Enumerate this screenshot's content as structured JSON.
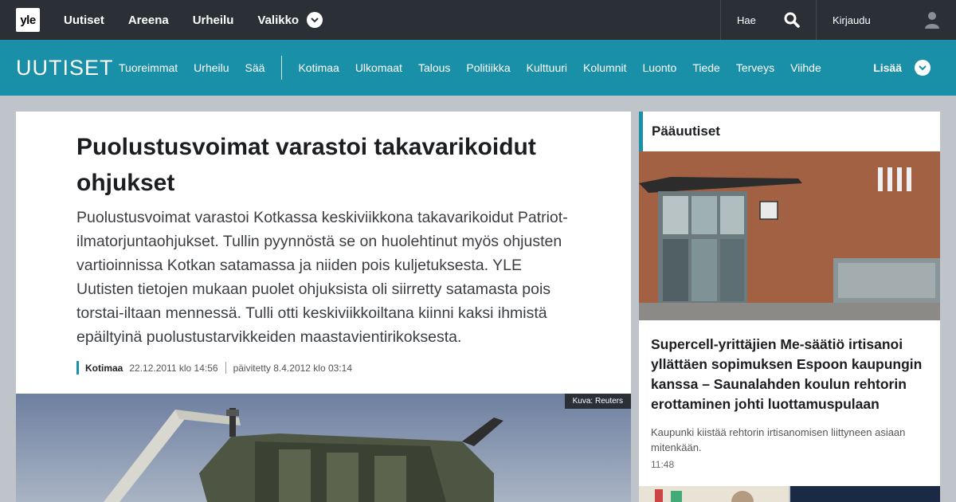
{
  "topbar": {
    "logo": "yle",
    "nav": [
      "Uutiset",
      "Areena",
      "Urheilu"
    ],
    "valikko": "Valikko",
    "search_label": "Hae",
    "login_label": "Kirjaudu"
  },
  "sectionbar": {
    "logo": "UUTISET",
    "left_items": [
      "Tuoreimmat",
      "Urheilu",
      "Sää"
    ],
    "right_items": [
      "Kotimaa",
      "Ulkomaat",
      "Talous",
      "Politiikka",
      "Kulttuuri",
      "Kolumnit",
      "Luonto",
      "Tiede",
      "Terveys",
      "Viihde"
    ],
    "more": "Lisää"
  },
  "article": {
    "title": "Puolustusvoimat varastoi takavarikoidut ohjukset",
    "lead": "Puolustusvoimat varastoi Kotkassa keskiviikkona takavarikoidut Patriot-ilmatorjuntaohjukset. Tullin pyynnöstä se on huolehtinut myös ohjusten vartioinnissa Kotkan satamassa ja niiden pois kuljetuksesta. YLE Uutisten tietojen mukaan puolet ohjuksista oli siirretty satamasta pois torstai-iltaan mennessä. Tulli otti keskiviikkoiltana kiinni kaksi ihmistä epäiltyinä puolustustarvikkeiden maastavientirikoksesta.",
    "category": "Kotimaa",
    "published": "22.12.2011 klo 14:56",
    "updated": "päivitetty 8.4.2012 klo 03:14",
    "photo_credit": "Kuva: Reuters"
  },
  "side": {
    "heading": "Pääuutiset",
    "title": "Supercell-yrittäjien Me-säätiö irtisanoi yllättäen sopimuksen Espoon kaupungin kanssa – Saunalahden koulun rehtorin erottaminen johti luottamuspulaan",
    "summary": "Kaupunki kiistää rehtorin irtisanomisen liittyneen asiaan mitenkään.",
    "time": "11:48"
  },
  "colors": {
    "topbar": "#2b2f36",
    "accent": "#1a8fa8",
    "background": "#bfc3ca"
  }
}
